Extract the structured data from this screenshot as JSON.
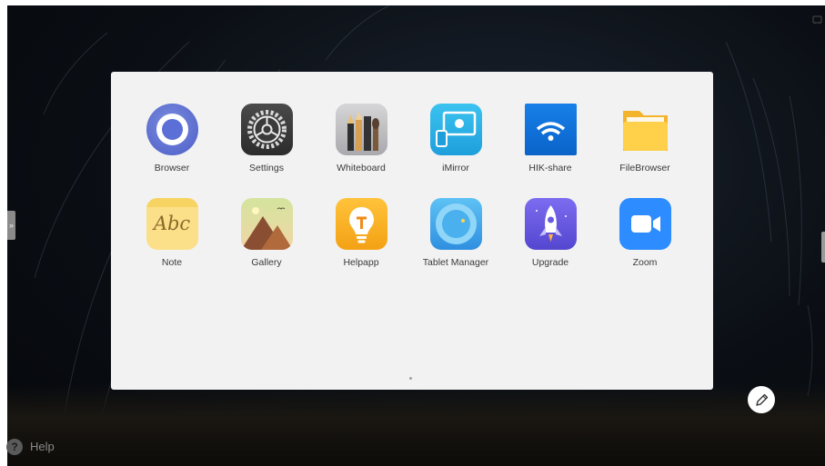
{
  "sidebar": {
    "expand_glyph": "»"
  },
  "apps": [
    {
      "label": "Browser",
      "icon": "browser-icon"
    },
    {
      "label": "Settings",
      "icon": "settings-icon"
    },
    {
      "label": "Whiteboard",
      "icon": "whiteboard-icon"
    },
    {
      "label": "iMirror",
      "icon": "imirror-icon"
    },
    {
      "label": "HIK-share",
      "icon": "hik-share-icon"
    },
    {
      "label": "FileBrowser",
      "icon": "filebrowser-icon"
    },
    {
      "label": "Note",
      "icon": "note-icon",
      "icon_text": "Abc"
    },
    {
      "label": "Gallery",
      "icon": "gallery-icon"
    },
    {
      "label": "Helpapp",
      "icon": "helpapp-icon"
    },
    {
      "label": "Tablet Manager",
      "icon": "tablet-manager-icon"
    },
    {
      "label": "Upgrade",
      "icon": "upgrade-icon"
    },
    {
      "label": "Zoom",
      "icon": "zoom-icon"
    }
  ],
  "pagination": {
    "current": 1,
    "total": 1
  },
  "help": {
    "glyph": "?",
    "label": "Help"
  }
}
